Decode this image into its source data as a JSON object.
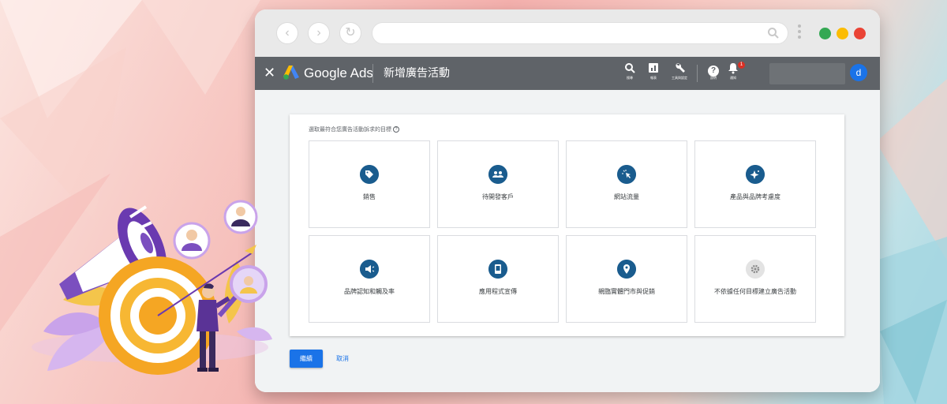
{
  "browser": {
    "nav": {
      "back_icon": "‹",
      "forward_icon": "›",
      "reload_icon": "↻"
    },
    "window_dots": [
      "#34a853",
      "#fbbc04",
      "#ea4335"
    ]
  },
  "header": {
    "close_icon": "✕",
    "brand": "Google Ads",
    "page_title": "新增廣告活動",
    "tools": [
      {
        "icon": "search-icon",
        "glyph": "🔍",
        "label": "搜尋"
      },
      {
        "icon": "report-icon",
        "glyph": "▮",
        "label": "報表"
      },
      {
        "icon": "wrench-icon",
        "glyph": "🔧",
        "label": "工具與設定"
      },
      {
        "icon": "help-icon",
        "glyph": "?",
        "label": "說明"
      },
      {
        "icon": "bell-icon",
        "glyph": "🔔",
        "label": "通知"
      }
    ],
    "notification_count": "1",
    "avatar_letter": "d"
  },
  "card": {
    "prompt": "選取最符合您廣告活動訴求的目標",
    "help_glyph": "?",
    "goals": [
      {
        "label": "銷售",
        "icon": "tag-icon",
        "glyph": "🏷"
      },
      {
        "label": "待開發客戶",
        "icon": "people-icon",
        "glyph": "👥"
      },
      {
        "label": "網站流量",
        "icon": "cursor-click-icon",
        "glyph": "✶"
      },
      {
        "label": "產品與品牌考慮度",
        "icon": "sparkle-icon",
        "glyph": "✦"
      },
      {
        "label": "品牌認知和觸及率",
        "icon": "megaphone-icon",
        "glyph": "📢"
      },
      {
        "label": "應用程式宣傳",
        "icon": "phone-icon",
        "glyph": "▯"
      },
      {
        "label": "親臨實體門市與促銷",
        "icon": "location-pin-icon",
        "glyph": "⬤"
      },
      {
        "label": "不依據任何目標建立廣告活動",
        "icon": "gear-icon",
        "glyph": "⚙"
      }
    ]
  },
  "actions": {
    "continue": "繼續",
    "cancel": "取消"
  }
}
